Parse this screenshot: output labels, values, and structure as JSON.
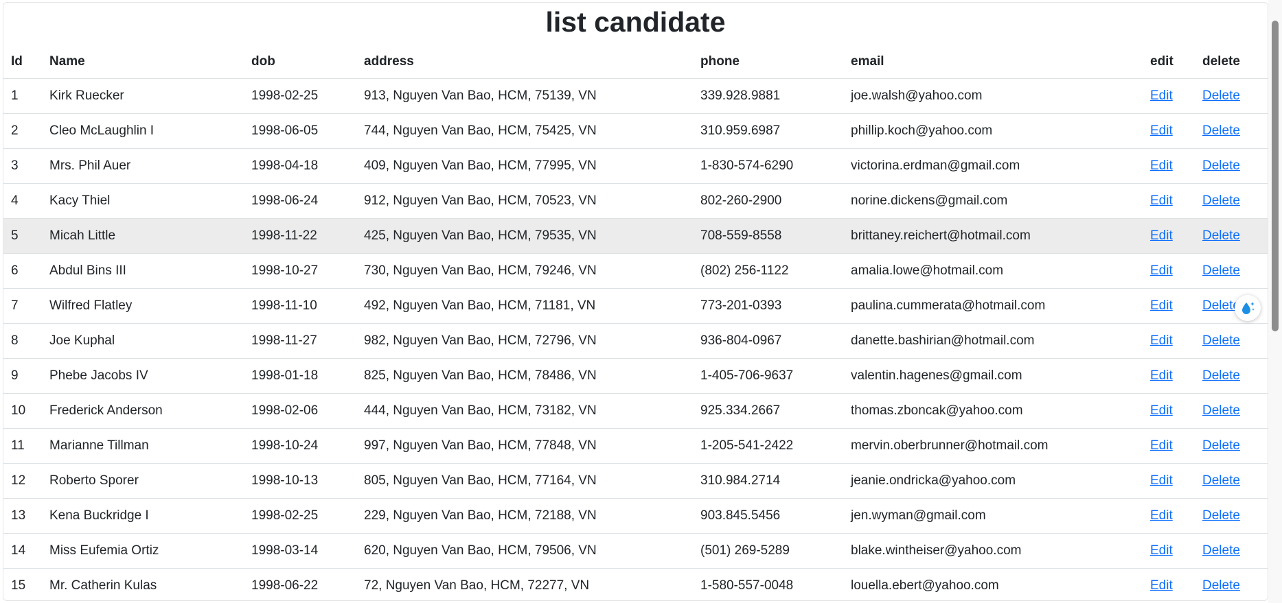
{
  "page": {
    "title": "list candidate"
  },
  "table": {
    "headers": {
      "id": "Id",
      "name": "Name",
      "dob": "dob",
      "address": "address",
      "phone": "phone",
      "email": "email",
      "edit": "edit",
      "delete": "delete"
    },
    "edit_label": "Edit",
    "delete_label": "Delete",
    "hovered_row_id": "5",
    "rows": [
      {
        "id": "1",
        "name": "Kirk Ruecker",
        "dob": "1998-02-25",
        "address": "913, Nguyen Van Bao, HCM, 75139, VN",
        "phone": "339.928.9881",
        "email": "joe.walsh@yahoo.com"
      },
      {
        "id": "2",
        "name": "Cleo McLaughlin I",
        "dob": "1998-06-05",
        "address": "744, Nguyen Van Bao, HCM, 75425, VN",
        "phone": "310.959.6987",
        "email": "phillip.koch@yahoo.com"
      },
      {
        "id": "3",
        "name": "Mrs. Phil Auer",
        "dob": "1998-04-18",
        "address": "409, Nguyen Van Bao, HCM, 77995, VN",
        "phone": "1-830-574-6290",
        "email": "victorina.erdman@gmail.com"
      },
      {
        "id": "4",
        "name": "Kacy Thiel",
        "dob": "1998-06-24",
        "address": "912, Nguyen Van Bao, HCM, 70523, VN",
        "phone": "802-260-2900",
        "email": "norine.dickens@gmail.com"
      },
      {
        "id": "5",
        "name": "Micah Little",
        "dob": "1998-11-22",
        "address": "425, Nguyen Van Bao, HCM, 79535, VN",
        "phone": "708-559-8558",
        "email": "brittaney.reichert@hotmail.com"
      },
      {
        "id": "6",
        "name": "Abdul Bins III",
        "dob": "1998-10-27",
        "address": "730, Nguyen Van Bao, HCM, 79246, VN",
        "phone": "(802) 256-1122",
        "email": "amalia.lowe@hotmail.com"
      },
      {
        "id": "7",
        "name": "Wilfred Flatley",
        "dob": "1998-11-10",
        "address": "492, Nguyen Van Bao, HCM, 71181, VN",
        "phone": "773-201-0393",
        "email": "paulina.cummerata@hotmail.com"
      },
      {
        "id": "8",
        "name": "Joe Kuphal",
        "dob": "1998-11-27",
        "address": "982, Nguyen Van Bao, HCM, 72796, VN",
        "phone": "936-804-0967",
        "email": "danette.bashirian@hotmail.com"
      },
      {
        "id": "9",
        "name": "Phebe Jacobs IV",
        "dob": "1998-01-18",
        "address": "825, Nguyen Van Bao, HCM, 78486, VN",
        "phone": "1-405-706-9637",
        "email": "valentin.hagenes@gmail.com"
      },
      {
        "id": "10",
        "name": "Frederick Anderson",
        "dob": "1998-02-06",
        "address": "444, Nguyen Van Bao, HCM, 73182, VN",
        "phone": "925.334.2667",
        "email": "thomas.zboncak@yahoo.com"
      },
      {
        "id": "11",
        "name": "Marianne Tillman",
        "dob": "1998-10-24",
        "address": "997, Nguyen Van Bao, HCM, 77848, VN",
        "phone": "1-205-541-2422",
        "email": "mervin.oberbrunner@hotmail.com"
      },
      {
        "id": "12",
        "name": "Roberto Sporer",
        "dob": "1998-10-13",
        "address": "805, Nguyen Van Bao, HCM, 77164, VN",
        "phone": "310.984.2714",
        "email": "jeanie.ondricka@yahoo.com"
      },
      {
        "id": "13",
        "name": "Kena Buckridge I",
        "dob": "1998-02-25",
        "address": "229, Nguyen Van Bao, HCM, 72188, VN",
        "phone": "903.845.5456",
        "email": "jen.wyman@gmail.com"
      },
      {
        "id": "14",
        "name": "Miss Eufemia Ortiz",
        "dob": "1998-03-14",
        "address": "620, Nguyen Van Bao, HCM, 79506, VN",
        "phone": "(501) 269-5289",
        "email": "blake.wintheiser@yahoo.com"
      },
      {
        "id": "15",
        "name": "Mr. Catherin Kulas",
        "dob": "1998-06-22",
        "address": "72, Nguyen Van Bao, HCM, 72277, VN",
        "phone": "1-580-557-0048",
        "email": "louella.ebert@yahoo.com"
      }
    ]
  },
  "widget": {
    "icon": "water-drop-sparkle-icon",
    "color": "#1a8fe3"
  },
  "colors": {
    "link": "#0d6efd",
    "hover_row": "#ececec",
    "text": "#212529"
  }
}
